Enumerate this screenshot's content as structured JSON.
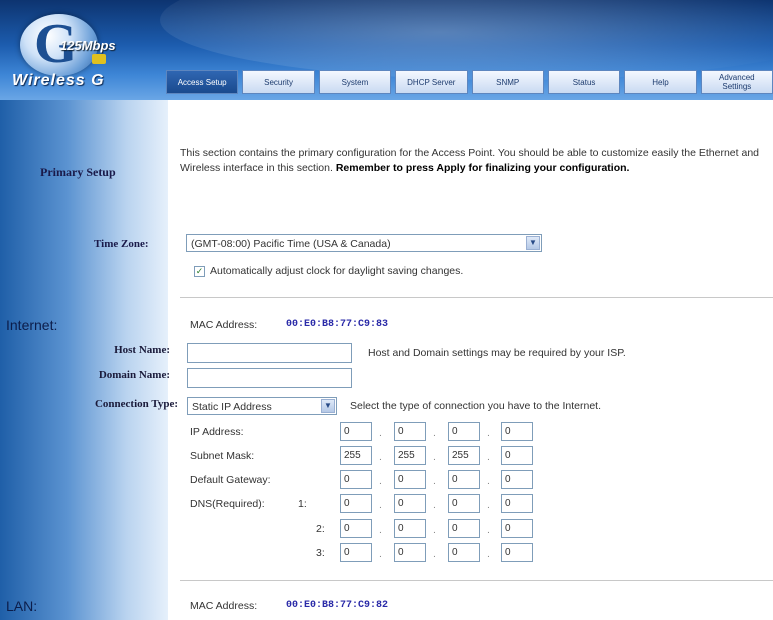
{
  "header": {
    "logo_speed": "125Mbps",
    "logo_brand": "Wireless G",
    "tabs": [
      {
        "label": "Access Setup",
        "active": true
      },
      {
        "label": "Security",
        "active": false
      },
      {
        "label": "System",
        "active": false
      },
      {
        "label": "DHCP Server",
        "active": false
      },
      {
        "label": "SNMP",
        "active": false
      },
      {
        "label": "Status",
        "active": false
      },
      {
        "label": "Help",
        "active": false
      },
      {
        "label": "Advanced Settings",
        "active": false
      }
    ]
  },
  "primary_setup": {
    "title": "Primary Setup",
    "intro_text": "This section contains the primary configuration for the Access Point. You should be able to customize easily the Ethernet and Wireless interface in this section.",
    "intro_bold": "Remember to press Apply for finalizing your configuration."
  },
  "time_zone": {
    "label": "Time Zone:",
    "value": "(GMT-08:00) Pacific Time (USA & Canada)",
    "dst_checked": true,
    "dst_label": "Automatically adjust clock for daylight saving changes."
  },
  "internet": {
    "title": "Internet:",
    "mac_label": "MAC Address:",
    "mac_value": "00:E0:B8:77:C9:83",
    "host_name_label": "Host Name:",
    "host_name_value": "",
    "domain_name_label": "Domain Name:",
    "domain_name_value": "",
    "isp_note": "Host and Domain settings may be required by your ISP.",
    "connection_type_label": "Connection Type:",
    "connection_type_value": "Static IP Address",
    "connection_note": "Select the type of connection you have to the Internet.",
    "ip_address_label": "IP Address:",
    "ip_address": [
      "0",
      "0",
      "0",
      "0"
    ],
    "subnet_mask_label": "Subnet Mask:",
    "subnet_mask": [
      "255",
      "255",
      "255",
      "0"
    ],
    "default_gateway_label": "Default Gateway:",
    "default_gateway": [
      "0",
      "0",
      "0",
      "0"
    ],
    "dns_label": "DNS(Required):",
    "dns": [
      {
        "index": "1:",
        "octets": [
          "0",
          "0",
          "0",
          "0"
        ]
      },
      {
        "index": "2:",
        "octets": [
          "0",
          "0",
          "0",
          "0"
        ]
      },
      {
        "index": "3:",
        "octets": [
          "0",
          "0",
          "0",
          "0"
        ]
      }
    ]
  },
  "lan": {
    "title": "LAN:",
    "mac_label": "MAC Address:",
    "mac_value": "00:E0:B8:77:C9:82"
  },
  "colors": {
    "header_dark": "#0d3470",
    "header_light": "#6aa6e6",
    "mac_value": "#2a2aa8"
  }
}
